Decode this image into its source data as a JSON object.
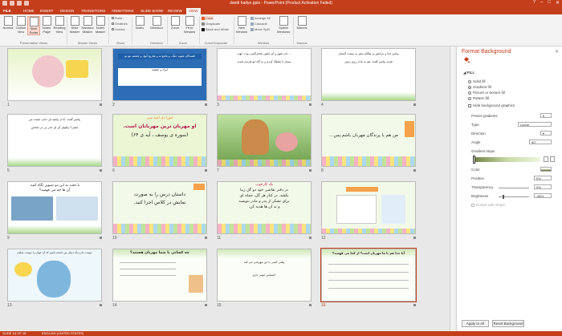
{
  "window": {
    "title": "dandi hadye.pptx - PowerPoint (Product Activation Failed)",
    "controls": [
      "?",
      "–",
      "□",
      "✕"
    ]
  },
  "tabs": [
    {
      "label": "FILE",
      "active": false
    },
    {
      "label": "HOME",
      "active": false
    },
    {
      "label": "INSERT",
      "active": false
    },
    {
      "label": "DESIGN",
      "active": false
    },
    {
      "label": "TRANSITIONS",
      "active": false
    },
    {
      "label": "ANIMATIONS",
      "active": false
    },
    {
      "label": "SLIDE SHOW",
      "active": false
    },
    {
      "label": "REVIEW",
      "active": false
    },
    {
      "label": "VIEW",
      "active": true
    }
  ],
  "ribbon": {
    "presentation_views": [
      "Normal",
      "Outline View",
      "Slide Sorter",
      "Notes Page",
      "Reading View"
    ],
    "master_views": [
      "Slide Master",
      "Handout Master",
      "Notes Master"
    ],
    "show": [
      "Ruler",
      "Gridlines",
      "Guides"
    ],
    "notes": "Notes",
    "direction": "Direction",
    "zoom": [
      "Zoom",
      "Fit to Window"
    ],
    "color": [
      "Color",
      "Grayscale",
      "Black and White"
    ],
    "window": [
      "New Window",
      "Arrange All",
      "Cascade",
      "Move Split"
    ],
    "switch_windows": "Switch Windows",
    "macros": "Macros",
    "group_labels": [
      "Presentation Views",
      "Master Views",
      "Show",
      "Direction",
      "Zoom",
      "Color/Grayscale",
      "Window",
      "Macros"
    ]
  },
  "slides": [
    {
      "num": "1",
      "lines": []
    },
    {
      "num": "2",
      "lines": [
        "قصدگان شوید جنگ، و نتامع نه و تقاریج آنها، و چشمه مو نو",
        "ایراد و چشمه"
      ]
    },
    {
      "num": "3",
      "lines": [
        "... دان شهر و آنه ایشن شاعرگسی یوت جهت",
        "بسیار با شاهگ کردم و به گاه ایو فرندم شدید"
      ]
    },
    {
      "num": "4",
      "lines": [
        "پیامبر خدا و یارانش به هنگام سفر به سمت گستان",
        "شدند پیامبر گفت: هم به ما از روی زمین"
      ]
    },
    {
      "num": "5",
      "lines": [
        "پیامبر گفت: آیا از بیکینه ای دادم، غیمت من",
        "ایمنی؟ بیکوای آی ای اندر بی نی شناس"
      ]
    },
    {
      "num": "6",
      "lines": [
        "حورا دی امیه سی",
        "او مهربان ترین مهربانان است.",
        "(سوره ی یوسف ، آیه ی ۶۴)"
      ]
    },
    {
      "num": "7",
      "lines": []
    },
    {
      "num": "8",
      "lines": [
        "من هم با پرندگان مهربان باشم.پس…"
      ]
    },
    {
      "num": "9",
      "lines": [
        "با دقت به این دو تصویر نگاه کنید.",
        "آن ها چه می فهمید؟"
      ]
    },
    {
      "num": "10",
      "lines": [
        "داستان درس را به صورت",
        "نمایش در کلاس اجرا کنید."
      ]
    },
    {
      "num": "11",
      "lines": [
        "یک کارخوب",
        "در دفتر نقاشی خود دو گل زیبا",
        "بکشد. در کنار هر گل، جمله ای",
        "برای تشکر از پدر و مادر بنویسد",
        "و به آن ها هدیه کن."
      ]
    },
    {
      "num": "12",
      "lines": []
    },
    {
      "num": "13",
      "lines": [
        "دوست دارم یک دنیای من داشته باشم که آن جهان را دوست میکنم"
      ]
    },
    {
      "num": "14",
      "lines": [
        "چه کسانی با شما مهربان هستند؟"
      ]
    },
    {
      "num": "15",
      "lines": [
        "وقتی کسی با من مهربانی می کند",
        "احساس خوبی دارم"
      ]
    },
    {
      "num": "16",
      "lines": [
        "آیا خدا هم با ما مهربان است؟ از کجا می فهمید؟"
      ]
    }
  ],
  "pane": {
    "title": "Format Background",
    "section": "FILL",
    "fill_options": [
      {
        "label": "Solid fill",
        "on": false
      },
      {
        "label": "Gradient fill",
        "on": true
      },
      {
        "label": "Picture or texture fill",
        "on": false
      },
      {
        "label": "Pattern fill",
        "on": false
      }
    ],
    "hide_graphics": "Hide background graphics",
    "preset_gradients": "Preset gradients",
    "type_label": "Type",
    "type_value": "Linear",
    "direction_label": "Direction",
    "angle_label": "Angle",
    "angle_value": "90°",
    "gradient_stops": "Gradient stops",
    "color_label": "Color",
    "position_label": "Position",
    "position_value": "0%",
    "transparency_label": "Transparency",
    "transparency_value": "0%",
    "brightness_label": "Brightness",
    "brightness_value": "-85%",
    "rotate_label": "Rotate with shape",
    "apply_all": "Apply to All",
    "reset": "Reset Background"
  },
  "status": {
    "slide": "SLIDE 16 OF 16",
    "language": "ENGLISH (UNITED STATES)"
  },
  "colors": {
    "accent": "#c43e1c",
    "selected_slide_border": "#c43e1c",
    "sorter_bg": "#e8e8e8"
  }
}
